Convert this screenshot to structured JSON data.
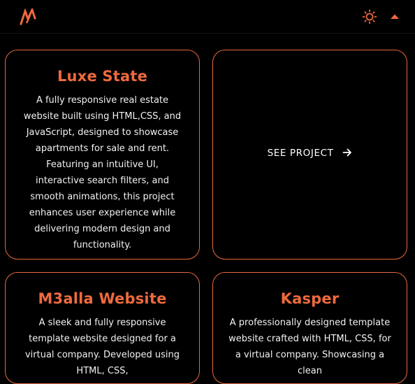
{
  "colors": {
    "accent": "#ee6a3e",
    "border": "#e8693c",
    "background": "#000000",
    "text": "#ffffff"
  },
  "header": {
    "logo_icon": "mw-logo-icon",
    "theme_icon": "sun-icon",
    "scroll_icon": "chevron-up-icon"
  },
  "projects": [
    {
      "title": "Luxe State",
      "description": "A fully responsive real estate website built using HTML,CSS, and JavaScript, designed to showcase apartments for sale and rent. Featuring an intuitive UI, interactive search filters, and smooth animations, this project enhances user experience while delivering modern design and functionality."
    },
    {
      "title": "M3alla Website",
      "description": "A sleek and fully responsive template website designed for a virtual company. Developed using HTML, CSS,"
    },
    {
      "title": "Kasper",
      "description": "A professionally designed template website crafted with HTML, CSS, for a virtual company. Showcasing a clean"
    }
  ],
  "see_project": {
    "label": "SEE PROJECT",
    "icon": "arrow-right-icon"
  }
}
